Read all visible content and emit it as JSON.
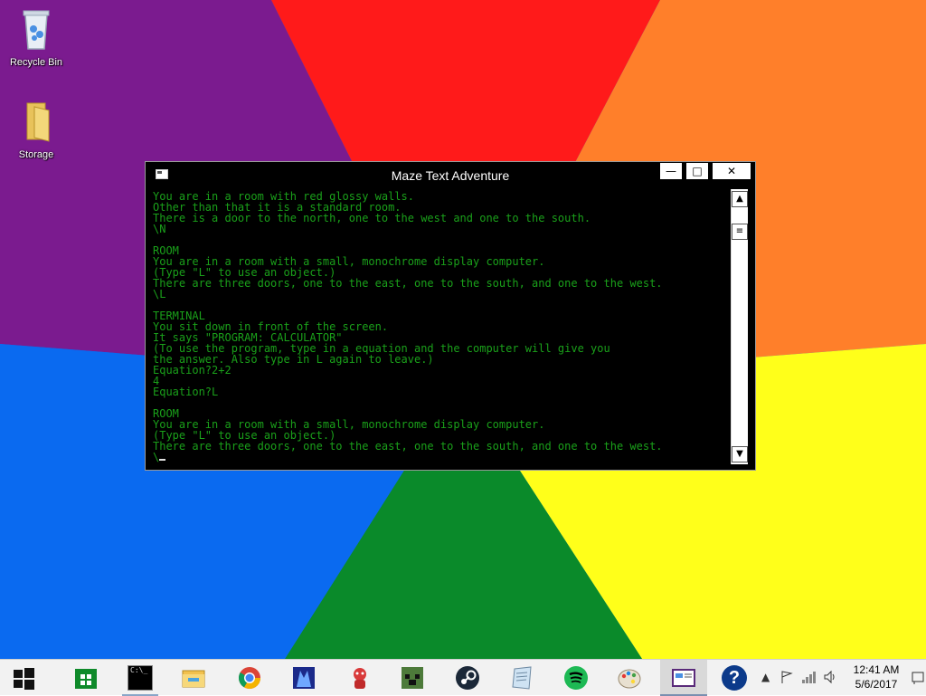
{
  "desktop": {
    "icons": [
      {
        "label": "Recycle Bin",
        "icon": "recycle-bin-icon"
      },
      {
        "label": "Storage",
        "icon": "folder-icon"
      }
    ],
    "wallpaper_colors": [
      "#7b1b8f",
      "#ff1a1a",
      "#ff7f2a",
      "#ffff1a",
      "#0a9a2a",
      "#0a6af0"
    ]
  },
  "window": {
    "title": "Maze Text Adventure",
    "controls": {
      "minimize": "—",
      "maximize": "□",
      "close": "✕"
    },
    "text_color": "#1aa01a",
    "lines": [
      "You are in a room with red glossy walls.",
      "Other than that it is a standard room.",
      "There is a door to the north, one to the west and one to the south.",
      "\\N",
      "",
      "ROOM",
      "You are in a room with a small, monochrome display computer.",
      "(Type \"L\" to use an object.)",
      "There are three doors, one to the east, one to the south, and one to the west.",
      "\\L",
      "",
      "TERMINAL",
      "You sit down in front of the screen.",
      "It says \"PROGRAM: CALCULATOR\"",
      "(To use the program, type in a equation and the computer will give you",
      "the answer. Also type in L again to leave.)",
      "Equation?2+2",
      "4",
      "Equation?L",
      "",
      "ROOM",
      "You are in a room with a small, monochrome display computer.",
      "(Type \"L\" to use an object.)",
      "There are three doors, one to the east, one to the south, and one to the west."
    ],
    "prompt": "\\"
  },
  "taskbar": {
    "items": [
      {
        "name": "start-button-icon"
      },
      {
        "name": "store-icon"
      },
      {
        "name": "command-prompt-icon",
        "label": "C:\\_"
      },
      {
        "name": "file-explorer-icon"
      },
      {
        "name": "chrome-icon"
      },
      {
        "name": "app-icon-1"
      },
      {
        "name": "app-icon-2"
      },
      {
        "name": "minecraft-icon"
      },
      {
        "name": "steam-icon"
      },
      {
        "name": "notepad-icon"
      },
      {
        "name": "spotify-icon"
      },
      {
        "name": "paint-icon"
      },
      {
        "name": "console-window-icon"
      },
      {
        "name": "help-icon",
        "label": "?"
      }
    ],
    "time": "12:41 AM",
    "date": "5/6/2017"
  }
}
